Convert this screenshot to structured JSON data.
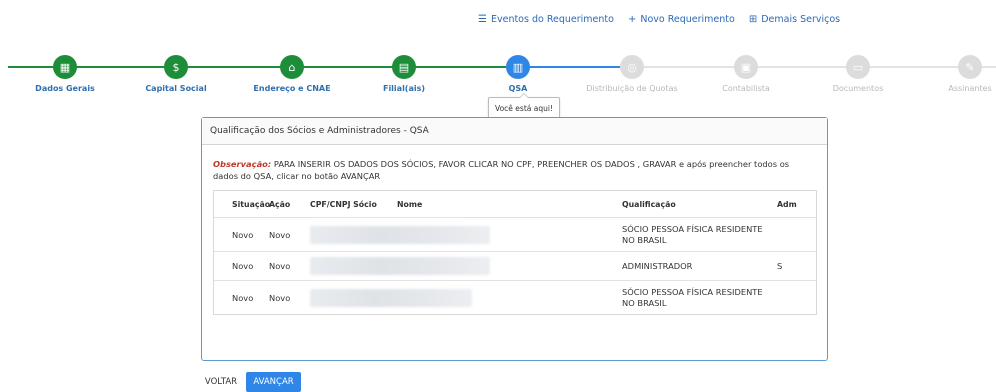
{
  "top_links": {
    "eventos": "Eventos do Requerimento",
    "novo": "Novo Requerimento",
    "servicos": "Demais Serviços"
  },
  "steps": [
    {
      "label": "Dados Gerais",
      "state": "done",
      "icon": "building-icon"
    },
    {
      "label": "Capital Social",
      "state": "done",
      "icon": "money-bag-icon"
    },
    {
      "label": "Endereço e CNAE",
      "state": "done",
      "icon": "map-pin-icon"
    },
    {
      "label": "Filial(ais)",
      "state": "done",
      "icon": "branch-building-icon"
    },
    {
      "label": "QSA",
      "state": "current",
      "icon": "partners-building-icon"
    },
    {
      "label": "Distribuição de Quotas",
      "state": "todo",
      "icon": "coins-icon"
    },
    {
      "label": "Contabilista",
      "state": "todo",
      "icon": "accountant-icon"
    },
    {
      "label": "Documentos",
      "state": "todo",
      "icon": "document-icon"
    },
    {
      "label": "Assinantes",
      "state": "todo",
      "icon": "signature-icon"
    }
  ],
  "tooltip": "Você está aqui!",
  "panel": {
    "title": "Qualificação dos Sócios e Administradores - QSA",
    "obs_keyword": "Observação:",
    "obs_text": " PARA INSERIR OS DADOS DOS SÓCIOS, FAVOR CLICAR NO CPF, PREENCHER OS DADOS , GRAVAR e após preencher todos os dados do QSA, clicar no botão AVANÇAR"
  },
  "table": {
    "headers": [
      "Situação",
      "Ação",
      "CPF/CNPJ Sócio",
      "Nome",
      "Qualificação",
      "Adm"
    ],
    "rows": [
      {
        "situacao": "Novo",
        "acao": "Novo",
        "qualificacao": "SÓCIO PESSOA FÍSICA RESIDENTE NO BRASIL",
        "adm": ""
      },
      {
        "situacao": "Novo",
        "acao": "Novo",
        "qualificacao": "ADMINISTRADOR",
        "adm": "S"
      },
      {
        "situacao": "Novo",
        "acao": "Novo",
        "qualificacao": "SÓCIO PESSOA FÍSICA RESIDENTE NO BRASIL",
        "adm": ""
      }
    ]
  },
  "buttons": {
    "voltar": "VOLTAR",
    "avancar": "AVANÇAR"
  },
  "colors": {
    "done": "#1e8d3a",
    "current": "#2f86e6",
    "todo": "#dcdcdc",
    "link": "#2a6ab8"
  }
}
